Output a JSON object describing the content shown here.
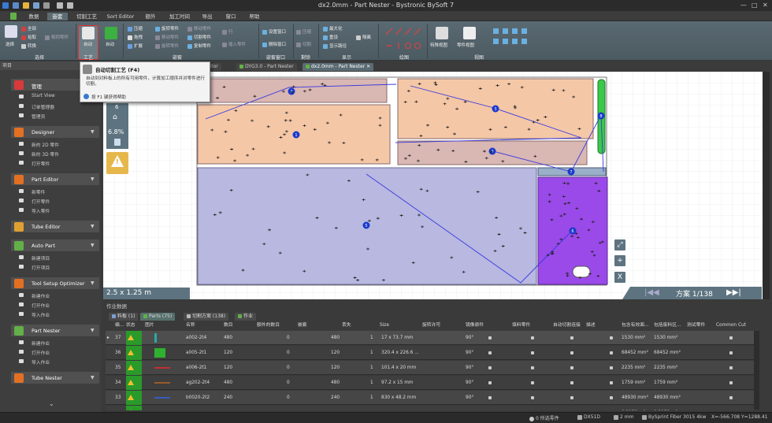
{
  "window": {
    "title": "dx2.0mm - Part Nester - Bystronic BySoft 7",
    "minimize": "—",
    "maximize": "□",
    "close": "✕"
  },
  "menus": [
    "数据",
    "嵌套",
    "切割工艺",
    "Sort Editor",
    "额外",
    "加工时间",
    "导出",
    "窗口",
    "帮助"
  ],
  "menus_active": "嵌套",
  "ribbon": {
    "select": {
      "group": "选择",
      "big": "选择",
      "items": [
        "全部",
        "拾取",
        "转换"
      ],
      "extra": "相同零件"
    },
    "craft": {
      "group": "工艺",
      "auto_craft": "自动"
    },
    "auto": {
      "label": "自动"
    },
    "nest": {
      "group": "嵌套",
      "items": [
        "压缩",
        "拖拽",
        "扩展",
        "旋转零件",
        "移动零件",
        "旋转零件",
        "移动零件",
        "切割零件",
        "复制零件"
      ],
      "fill": "插入零件",
      "row_insert": "行"
    },
    "window": {
      "group": "嵌套窗口",
      "items": [
        "设置窗口",
        "删除窗口"
      ]
    },
    "remnant": {
      "group": "剩馀",
      "items": [
        "压缩",
        "切割"
      ]
    },
    "display": {
      "group": "显示",
      "items": [
        "最大化",
        "重设",
        "显示路径",
        "隔离"
      ]
    },
    "draw": {
      "group": "绘图"
    },
    "view": {
      "group": "视图",
      "items": [
        "特殊视图",
        "零件视图"
      ]
    }
  },
  "tooltip": {
    "title": "自动切割工艺 (F4)",
    "body": "自动到对料板上的所有可用零件，计算加工顺序并对零件进行切割。",
    "help": "按 F1 键获得帮助"
  },
  "sidebar": {
    "header": "项目",
    "sections": [
      {
        "name": "管理",
        "items": [
          "Start View",
          "订单管理器",
          "管理员"
        ],
        "color": "#d8393a"
      },
      {
        "name": "Designer",
        "items": [
          "新的 2D 零件",
          "新的 3D 零件",
          "打开零件"
        ],
        "color": "#e37022"
      },
      {
        "name": "Part Editor",
        "items": [
          "新零件",
          "打开零件",
          "导入零件"
        ],
        "color": "#e37022"
      },
      {
        "name": "Tube Editor",
        "items": [],
        "color": "#e0a030"
      },
      {
        "name": "Auto Part",
        "items": [
          "新建项目",
          "打开项目"
        ],
        "color": "#62b047"
      },
      {
        "name": "Tool Setup Optimizer",
        "items": [
          "新建作业",
          "打开作业",
          "导入作业"
        ],
        "color": "#e37022"
      },
      {
        "name": "Part Nester",
        "items": [
          "新建作业",
          "打开作业",
          "导入作业"
        ],
        "color": "#62b047"
      },
      {
        "name": "Tube Nester",
        "items": [],
        "color": "#e37022"
      }
    ]
  },
  "tabs": [
    "Editor",
    "DYG3.0 - Part Nester",
    "dx2.0mm - Part Nester"
  ],
  "tabs_close": "✕",
  "canvas": {
    "utilization_top": "6",
    "utilization": "6.8%",
    "sheet_size": "2.5 x 1.25 m",
    "plan": "方案 1/138",
    "part_numbers": [
      "1",
      "2",
      "3",
      "4",
      "5",
      "6",
      "7",
      "8"
    ],
    "warning": "!"
  },
  "bottom": {
    "title": "作业数据",
    "tabs": [
      "料板 (1)",
      "Parts (75)",
      "切割方案 (138)",
      "作业"
    ],
    "columns": [
      "编...",
      "状态",
      "图片",
      "名称",
      "数目",
      "额外的数目",
      "嵌套",
      "丢失",
      "Size",
      "旋转许可",
      "镜像原件",
      "填料零件",
      "自动切割连接",
      "描述",
      "包含有效面...",
      "包括废料区...",
      "测试零件",
      "Common Cut"
    ],
    "rows": [
      {
        "id": "37",
        "name": "a002-2t4",
        "count": "480",
        "extra": "0",
        "nested": "480",
        "lost": "1",
        "size": "17 x 73.7 mm",
        "rot": "90°",
        "area1": "1530 mm²",
        "area2": "1530 mm²",
        "color": "#2aa8a8"
      },
      {
        "id": "36",
        "name": "a005-2t1",
        "count": "120",
        "extra": "0",
        "nested": "120",
        "lost": "1",
        "size": "320.4 x 226.6 ...",
        "rot": "90°",
        "area1": "68452 mm²",
        "area2": "68452 mm²",
        "color": "#2fb030"
      },
      {
        "id": "35",
        "name": "a006-2t1",
        "count": "120",
        "extra": "0",
        "nested": "120",
        "lost": "1",
        "size": "101.4 x 20 mm",
        "rot": "90°",
        "area1": "2235 mm²",
        "area2": "2235 mm²",
        "color": "#c03030"
      },
      {
        "id": "34",
        "name": "ag202-2t4",
        "count": "480",
        "extra": "0",
        "nested": "480",
        "lost": "1",
        "size": "97.2 x 15 mm",
        "rot": "90°",
        "area1": "1759 mm²",
        "area2": "1759 mm²",
        "color": "#9a5a2a"
      },
      {
        "id": "33",
        "name": "b0020-2t2",
        "count": "240",
        "extra": "0",
        "nested": "240",
        "lost": "1",
        "size": "830 x 48.2 mm",
        "rot": "90°",
        "area1": "48930 mm²",
        "area2": "48930 mm²",
        "color": "#3a5ac0"
      },
      {
        "id": "32",
        "name": "b1215-2t2_99",
        "count": "240",
        "extra": "0",
        "nested": "240",
        "lost": "1",
        "size": "1045.2 x 172...",
        "rot": "90°",
        "area1": "0.2158 m²",
        "area2": "0.2158 m²",
        "color": "#3a3ad0"
      }
    ]
  },
  "status": {
    "selected": "0 所选零件",
    "material": "DX51D",
    "thickness": "2 mm",
    "machine": "BySprint Fiber 3015 4kw",
    "coords": "X=-566.708 Y=1288.41"
  },
  "overlay_buttons": [
    "+",
    "X"
  ],
  "icons": [
    "select-icon",
    "brush-icon",
    "auto-icon",
    "warning-icon",
    "home-icon",
    "trash-icon",
    "zoom-icon"
  ]
}
